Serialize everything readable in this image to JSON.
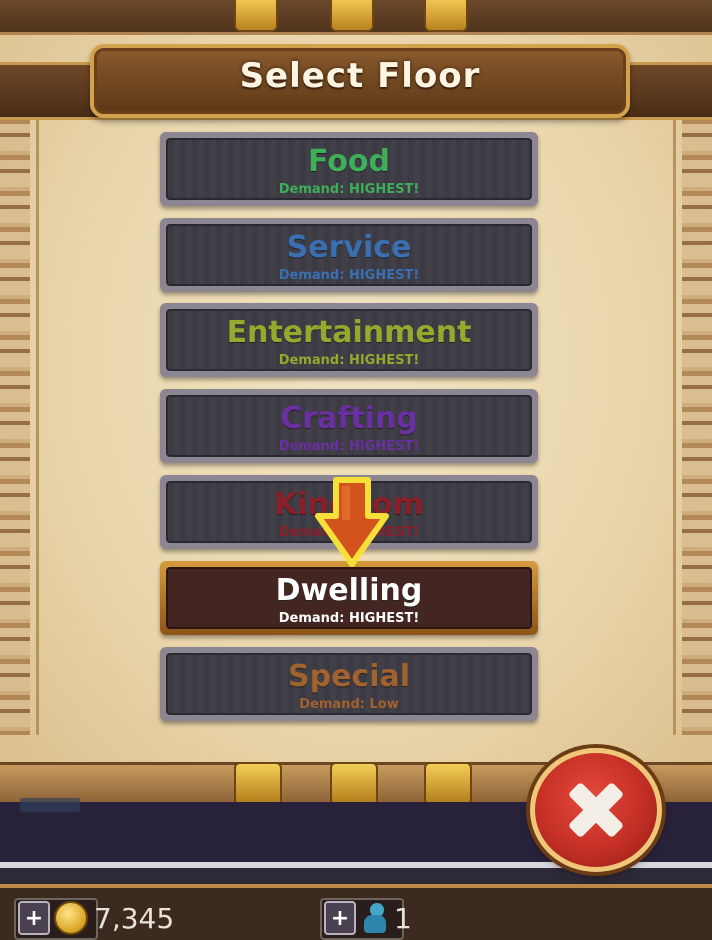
{
  "dialog": {
    "title": "Select Floor"
  },
  "floors": [
    {
      "name": "Food",
      "demand": "Demand: HIGHEST!",
      "color": "#3fae5a",
      "selected": false
    },
    {
      "name": "Service",
      "demand": "Demand: HIGHEST!",
      "color": "#3a6fb2",
      "selected": false
    },
    {
      "name": "Entertainment",
      "demand": "Demand: HIGHEST!",
      "color": "#96a82e",
      "selected": false
    },
    {
      "name": "Crafting",
      "demand": "Demand: HIGHEST!",
      "color": "#6a2fa0",
      "selected": false
    },
    {
      "name": "Kingdom",
      "demand": "Demand: HIGHEST!",
      "color": "#8a1f2a",
      "selected": false
    },
    {
      "name": "Dwelling",
      "demand": "Demand: HIGHEST!",
      "color": "#ffffff",
      "selected": true
    },
    {
      "name": "Special",
      "demand": "Demand: Low",
      "color": "#a0622e",
      "selected": false
    }
  ],
  "hud": {
    "coins": "7,345",
    "bux": "1",
    "plus_label": "+"
  },
  "icons": {
    "coin": "coin-icon",
    "bux": "bux-icon",
    "close": "close-icon",
    "pointer": "pointer-arrow-icon"
  }
}
